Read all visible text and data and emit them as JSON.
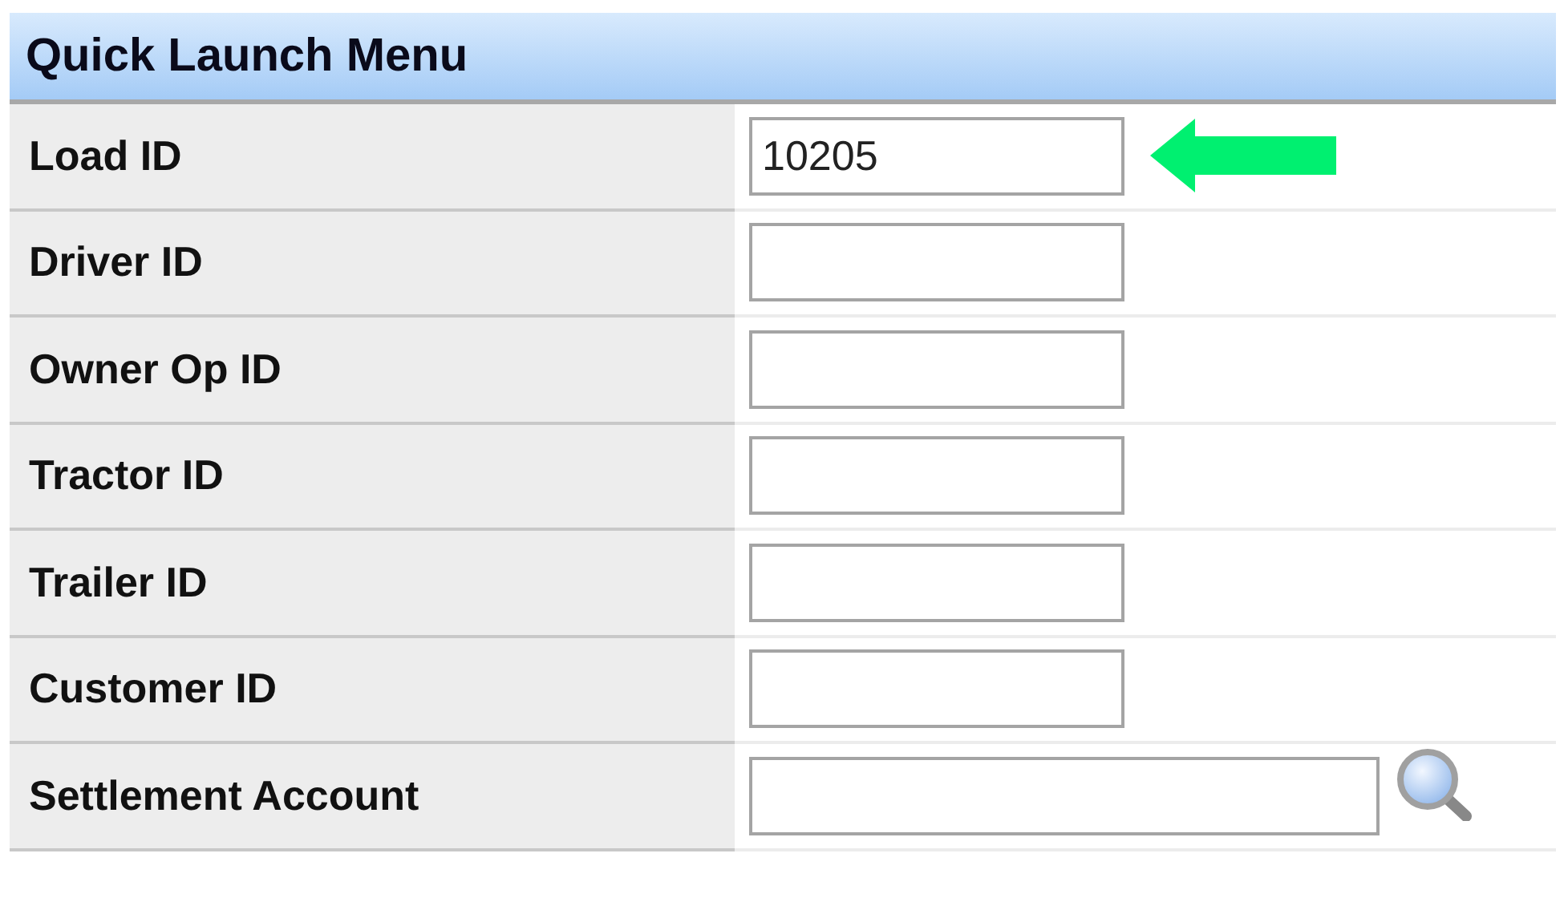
{
  "panel": {
    "title": "Quick Launch Menu"
  },
  "fields": [
    {
      "label": "Load ID",
      "value": "10205",
      "kind": "text",
      "marked": true
    },
    {
      "label": "Driver ID",
      "kind": "text",
      "marked": false
    },
    {
      "label": "Owner Op ID",
      "kind": "text",
      "marked": false
    },
    {
      "label": "Tractor ID",
      "kind": "text",
      "marked": false
    },
    {
      "label": "Trailer ID",
      "kind": "text",
      "marked": false
    },
    {
      "label": "Customer ID",
      "kind": "text",
      "marked": false
    },
    {
      "label": "Settlement Account",
      "kind": "lookup",
      "marked": false
    }
  ]
}
